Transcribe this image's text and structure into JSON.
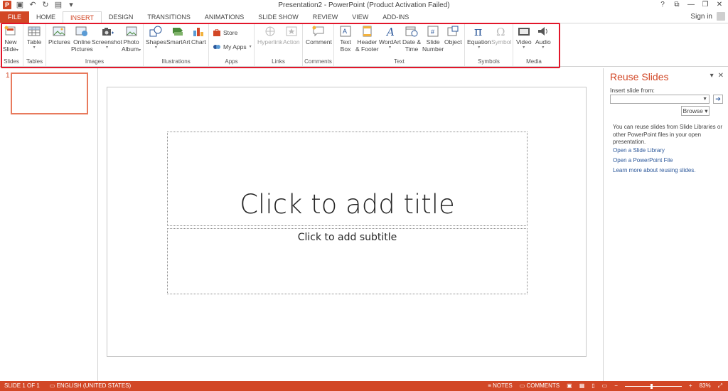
{
  "window": {
    "title": "Presentation2 - PowerPoint (Product Activation Failed)",
    "controls": [
      "?",
      "⧉",
      "—",
      "❐",
      "✕"
    ]
  },
  "qat": {
    "icons": [
      "powerpoint-logo",
      "save-icon",
      "undo-icon",
      "redo-icon",
      "start-from-beginning-icon",
      "customize-qat-icon"
    ]
  },
  "tabs": [
    "FILE",
    "HOME",
    "INSERT",
    "DESIGN",
    "TRANSITIONS",
    "ANIMATIONS",
    "SLIDE SHOW",
    "REVIEW",
    "VIEW",
    "ADD-INS"
  ],
  "active_tab": "INSERT",
  "account": {
    "signin": "Sign in"
  },
  "ribbon": {
    "slides": {
      "label": "Slides",
      "new_slide": "New",
      "new_slide_2": "Slide"
    },
    "tables": {
      "label": "Tables",
      "table": "Table"
    },
    "images": {
      "label": "Images",
      "pictures": "Pictures",
      "online": "Online",
      "online_2": "Pictures",
      "screenshot": "Screenshot",
      "photo": "Photo",
      "photo_2": "Album"
    },
    "illustrations": {
      "label": "Illustrations",
      "shapes": "Shapes",
      "smartart": "SmartArt",
      "chart": "Chart"
    },
    "apps": {
      "label": "Apps",
      "store": "Store",
      "myapps": "My Apps"
    },
    "links": {
      "label": "Links",
      "hyperlink": "Hyperlink",
      "action": "Action"
    },
    "comments": {
      "label": "Comments",
      "comment": "Comment"
    },
    "text": {
      "label": "Text",
      "textbox": "Text",
      "textbox_2": "Box",
      "header": "Header",
      "header_2": "& Footer",
      "wordart": "WordArt",
      "datetime": "Date &",
      "datetime_2": "Time",
      "slidenum": "Slide",
      "slidenum_2": "Number",
      "object": "Object"
    },
    "symbols": {
      "label": "Symbols",
      "equation": "Equation",
      "symbol": "Symbol"
    },
    "media": {
      "label": "Media",
      "video": "Video",
      "audio": "Audio"
    }
  },
  "thumbnails": {
    "number": "1"
  },
  "slide": {
    "title_placeholder": "Click to add title",
    "subtitle_placeholder": "Click to add subtitle"
  },
  "taskpane": {
    "title": "Reuse Slides",
    "insert_label": "Insert slide from:",
    "input_value": "",
    "browse": "Browse",
    "description": "You can reuse slides from Slide Libraries or other PowerPoint files in your open presentation.",
    "links": [
      "Open a Slide Library",
      "Open a PowerPoint File",
      "Learn more about reusing slides."
    ]
  },
  "statusbar": {
    "slide_count": "SLIDE 1 OF 1",
    "language": "ENGLISH (UNITED STATES)",
    "notes": "NOTES",
    "comments": "COMMENTS",
    "zoom": "83%"
  },
  "colors": {
    "accent": "#d24726",
    "highlight": "#e2162a",
    "link": "#2b579a"
  }
}
